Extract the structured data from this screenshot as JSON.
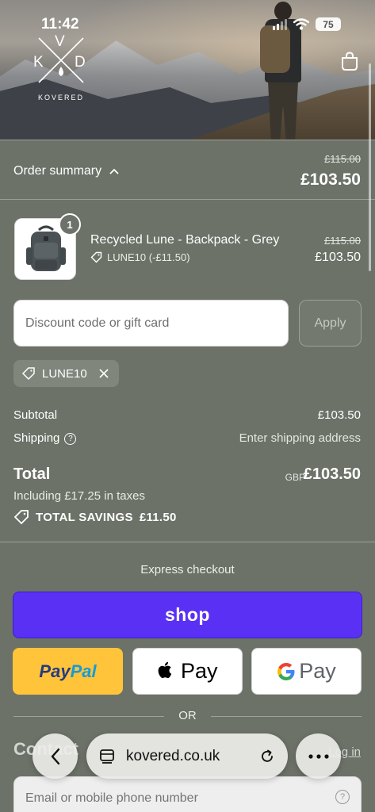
{
  "status_bar": {
    "time": "11:42",
    "battery": "75"
  },
  "brand": {
    "letters": [
      "V",
      "K",
      "D"
    ],
    "wordmark": "KOVERED"
  },
  "order_summary": {
    "label": "Order summary",
    "original_total": "£115.00",
    "total": "£103.50"
  },
  "product": {
    "quantity": "1",
    "name": "Recycled Lune - Backpack - Grey",
    "discount": "LUNE10 (-£11.50)",
    "original_price": "£115.00",
    "price": "£103.50"
  },
  "discount_form": {
    "placeholder": "Discount code or gift card",
    "apply_label": "Apply",
    "applied_code": "LUNE10"
  },
  "totals": {
    "subtotal_label": "Subtotal",
    "subtotal_value": "£103.50",
    "shipping_label": "Shipping",
    "shipping_value": "Enter shipping address",
    "total_label": "Total",
    "currency": "GBP",
    "total_value": "£103.50",
    "taxes": "Including £17.25 in taxes",
    "savings_label": "TOTAL SAVINGS",
    "savings_value": "£11.50"
  },
  "express": {
    "label": "Express checkout",
    "shop_label": "shop",
    "paypal_a": "Pay",
    "paypal_b": "Pal",
    "applepay_label": "Pay",
    "gpay_label": "Pay"
  },
  "or_label": "OR",
  "contact": {
    "heading": "Contact",
    "login": "Log in",
    "email_placeholder": "Email or mobile phone number"
  },
  "browser": {
    "url": "kovered.co.uk"
  },
  "colors": {
    "background": "#6c7268",
    "shop_pay": "#5a31f4",
    "paypal": "#ffc43a"
  }
}
